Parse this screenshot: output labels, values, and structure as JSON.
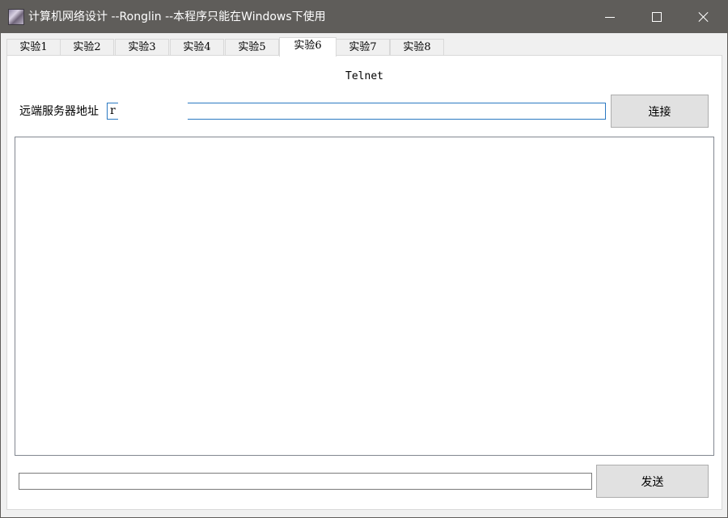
{
  "window": {
    "title": "计算机网络设计 --Ronglin  --本程序只能在Windows下使用",
    "icon": "app-icon"
  },
  "controls": {
    "minimize": "minimize-icon",
    "maximize": "maximize-icon",
    "close": "close-icon"
  },
  "tabs": [
    {
      "label": "实验1",
      "active": false
    },
    {
      "label": "实验2",
      "active": false
    },
    {
      "label": "实验3",
      "active": false
    },
    {
      "label": "实验4",
      "active": false
    },
    {
      "label": "实验5",
      "active": false
    },
    {
      "label": "实验6",
      "active": true
    },
    {
      "label": "实验7",
      "active": false
    },
    {
      "label": "实验8",
      "active": false
    }
  ],
  "panel": {
    "heading": "Telnet",
    "address_label": "远端服务器地址",
    "address_value": "r",
    "connect_button": "连接",
    "output_text": "",
    "send_value": "",
    "send_button": "发送"
  },
  "colors": {
    "titlebar": "#5f5d5a",
    "focus_border": "#2b79c2",
    "button_bg": "#e1e1e1"
  }
}
